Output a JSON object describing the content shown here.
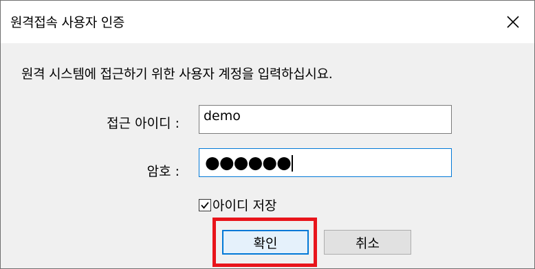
{
  "window": {
    "title": "원격접속 사용자 인증",
    "close_symbol": "×"
  },
  "instruction": "원격 시스템에 접근하기 위한 사용자 계정을 입력하십시요.",
  "id_field": {
    "label": "접근 아이디 :",
    "value": "demo"
  },
  "password_field": {
    "label": "암호 :",
    "masked_value": "●●●●●●"
  },
  "save_id": {
    "label": "아이디 저장",
    "checked": true
  },
  "buttons": {
    "ok_label": "확인",
    "cancel_label": "취소"
  },
  "colors": {
    "highlight": "#e8141b",
    "focus": "#0078d7",
    "dialog_bg": "#f0f0f0"
  }
}
